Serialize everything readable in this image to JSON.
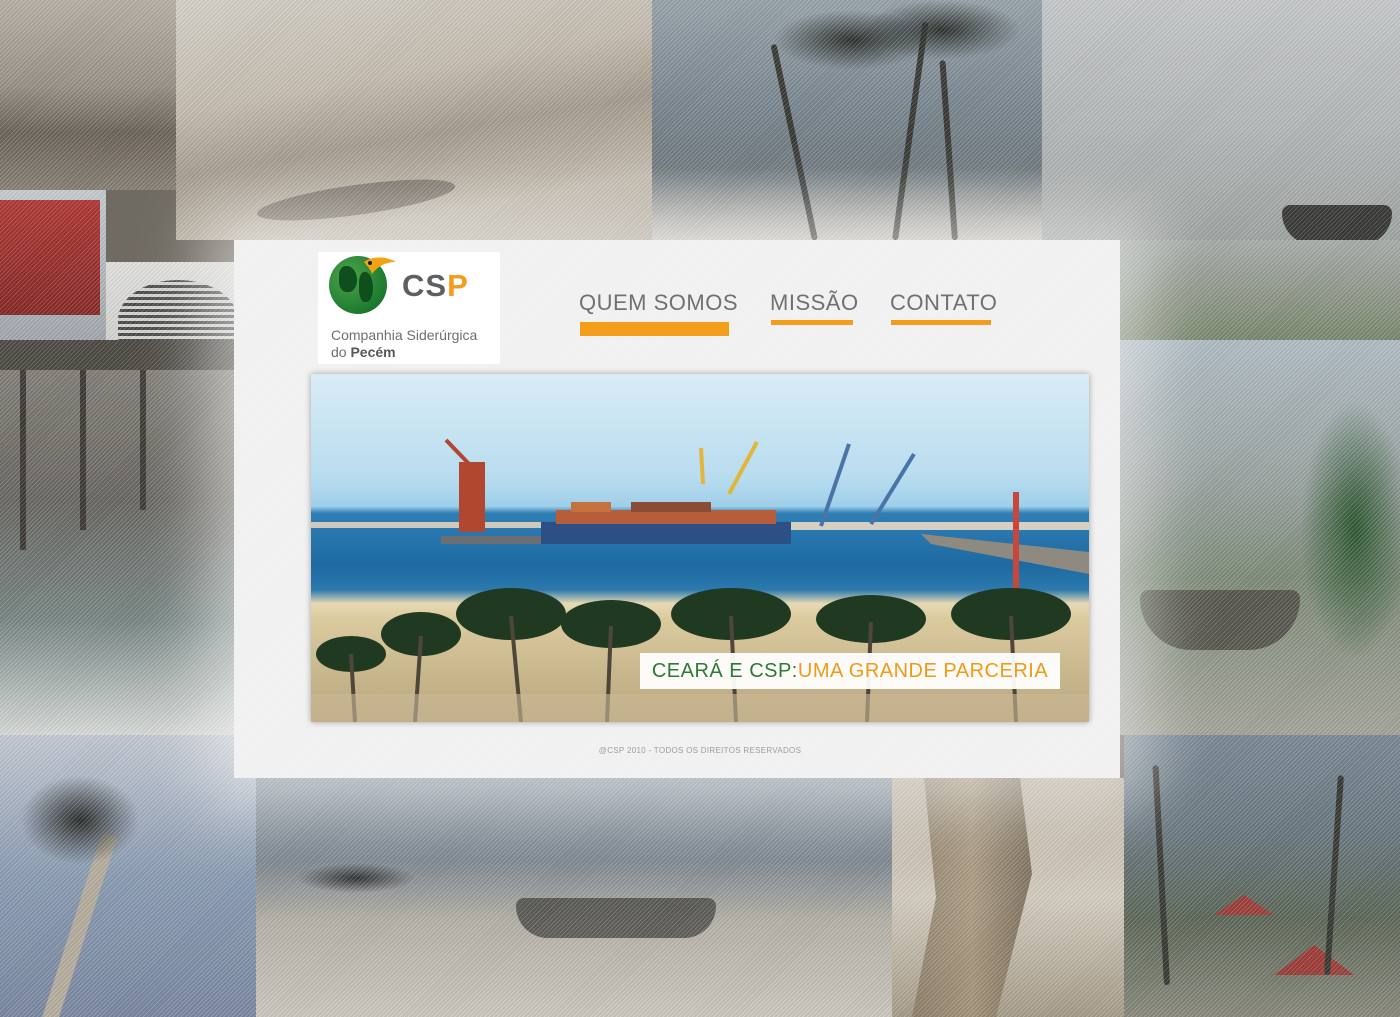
{
  "logo": {
    "letters_cs": "CS",
    "letter_p": "P",
    "company_line1": "Companhia Siderúrgica",
    "company_line2_prefix": "do ",
    "company_line2_bold": "Pecém"
  },
  "nav": {
    "items": [
      {
        "label": "QUEM SOMOS",
        "active": true
      },
      {
        "label": "MISSÃO",
        "active": false
      },
      {
        "label": "CONTATO",
        "active": false
      }
    ]
  },
  "hero": {
    "caption_part1": "CEARÁ E CSP: ",
    "caption_part2": "UMA GRANDE PARCERIA"
  },
  "footer": {
    "copyright": "@CSP 2010 - TODOS OS DIREITOS RESERVADOS"
  },
  "colors": {
    "accent_orange": "#f39d1a",
    "brand_green": "#2d7a37",
    "text_gray": "#6e7174"
  },
  "icons": {
    "logo": "csp-globe-toucan-icon"
  }
}
